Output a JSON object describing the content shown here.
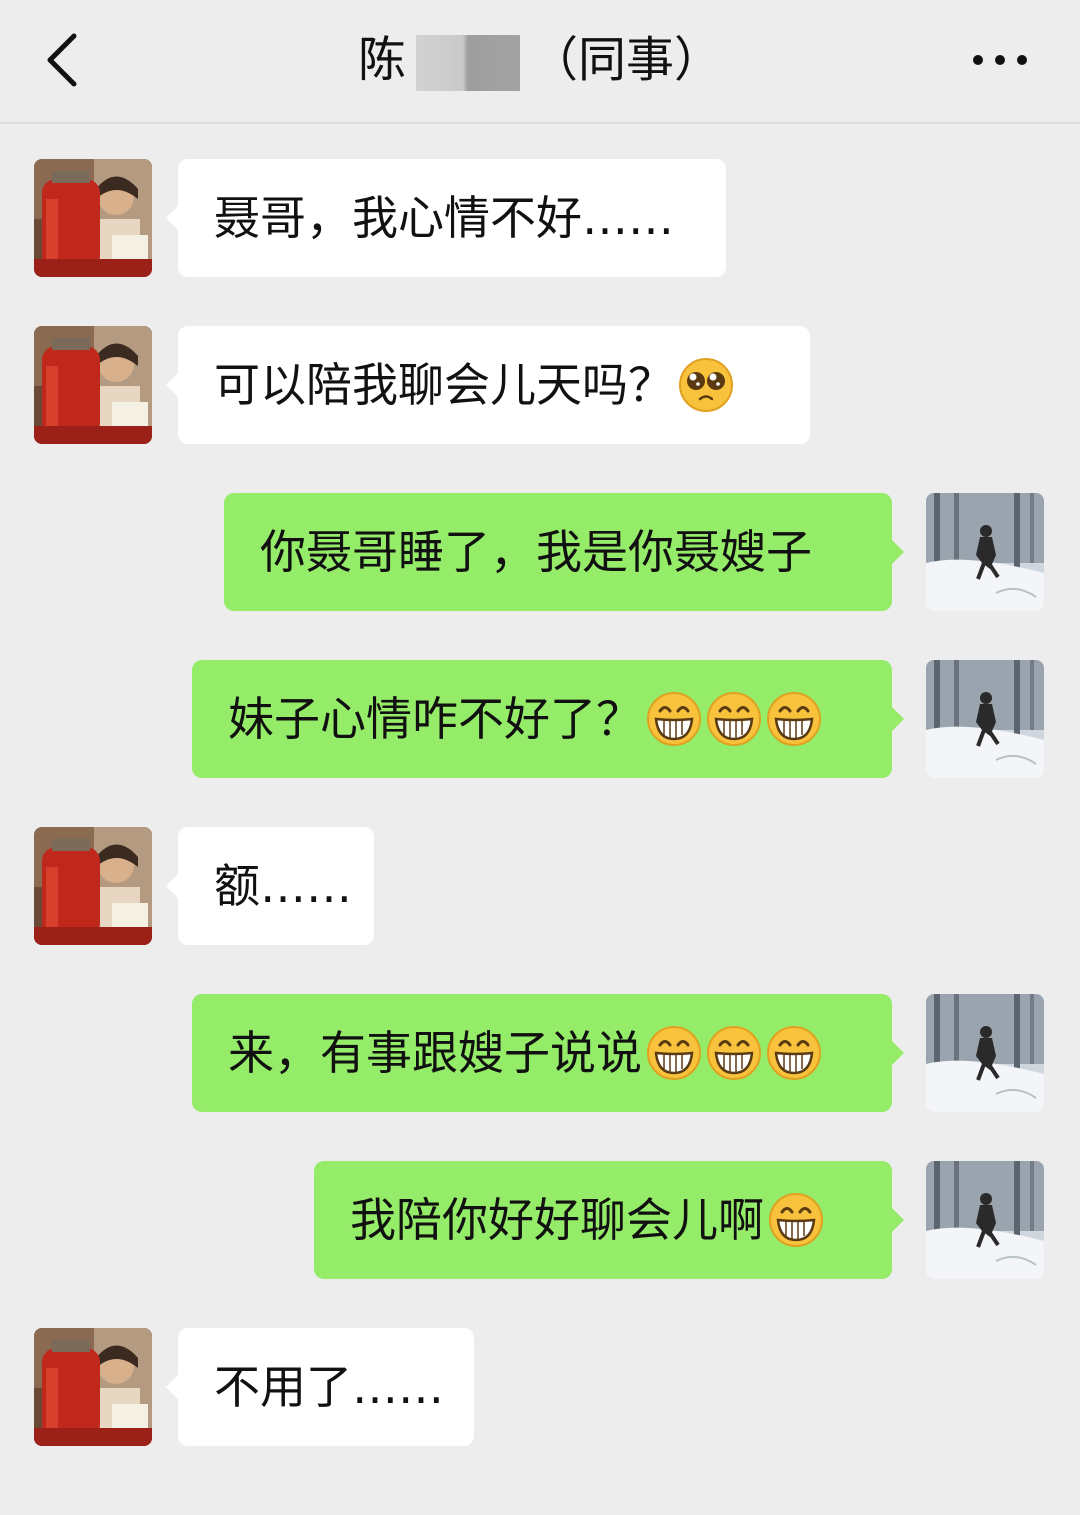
{
  "header": {
    "title_prefix": "陈",
    "title_suffix": "（同事）",
    "back_icon": "chevron-left-icon",
    "more_icon": "more-dots-icon"
  },
  "colors": {
    "background": "#ededed",
    "incoming_bubble": "#ffffff",
    "outgoing_bubble": "#95ec69",
    "text": "#111111"
  },
  "messages": [
    {
      "side": "in",
      "text": "聂哥，我心情不好……",
      "emojis": []
    },
    {
      "side": "in",
      "text": "可以陪我聊会儿天吗？",
      "emojis": [
        "pleading-emoji"
      ]
    },
    {
      "side": "out",
      "text": "你聂哥睡了，我是你聂嫂子",
      "emojis": []
    },
    {
      "side": "out",
      "text": "妹子心情咋不好了？",
      "emojis": [
        "grin-emoji",
        "grin-emoji",
        "grin-emoji"
      ]
    },
    {
      "side": "in",
      "text": "额……",
      "emojis": []
    },
    {
      "side": "out",
      "text": "来，有事跟嫂子说说",
      "emojis": [
        "grin-emoji",
        "grin-emoji",
        "grin-emoji"
      ]
    },
    {
      "side": "out",
      "text": "我陪你好好聊会儿啊",
      "emojis": [
        "grin-emoji"
      ]
    },
    {
      "side": "in",
      "text": "不用了……",
      "emojis": []
    }
  ]
}
